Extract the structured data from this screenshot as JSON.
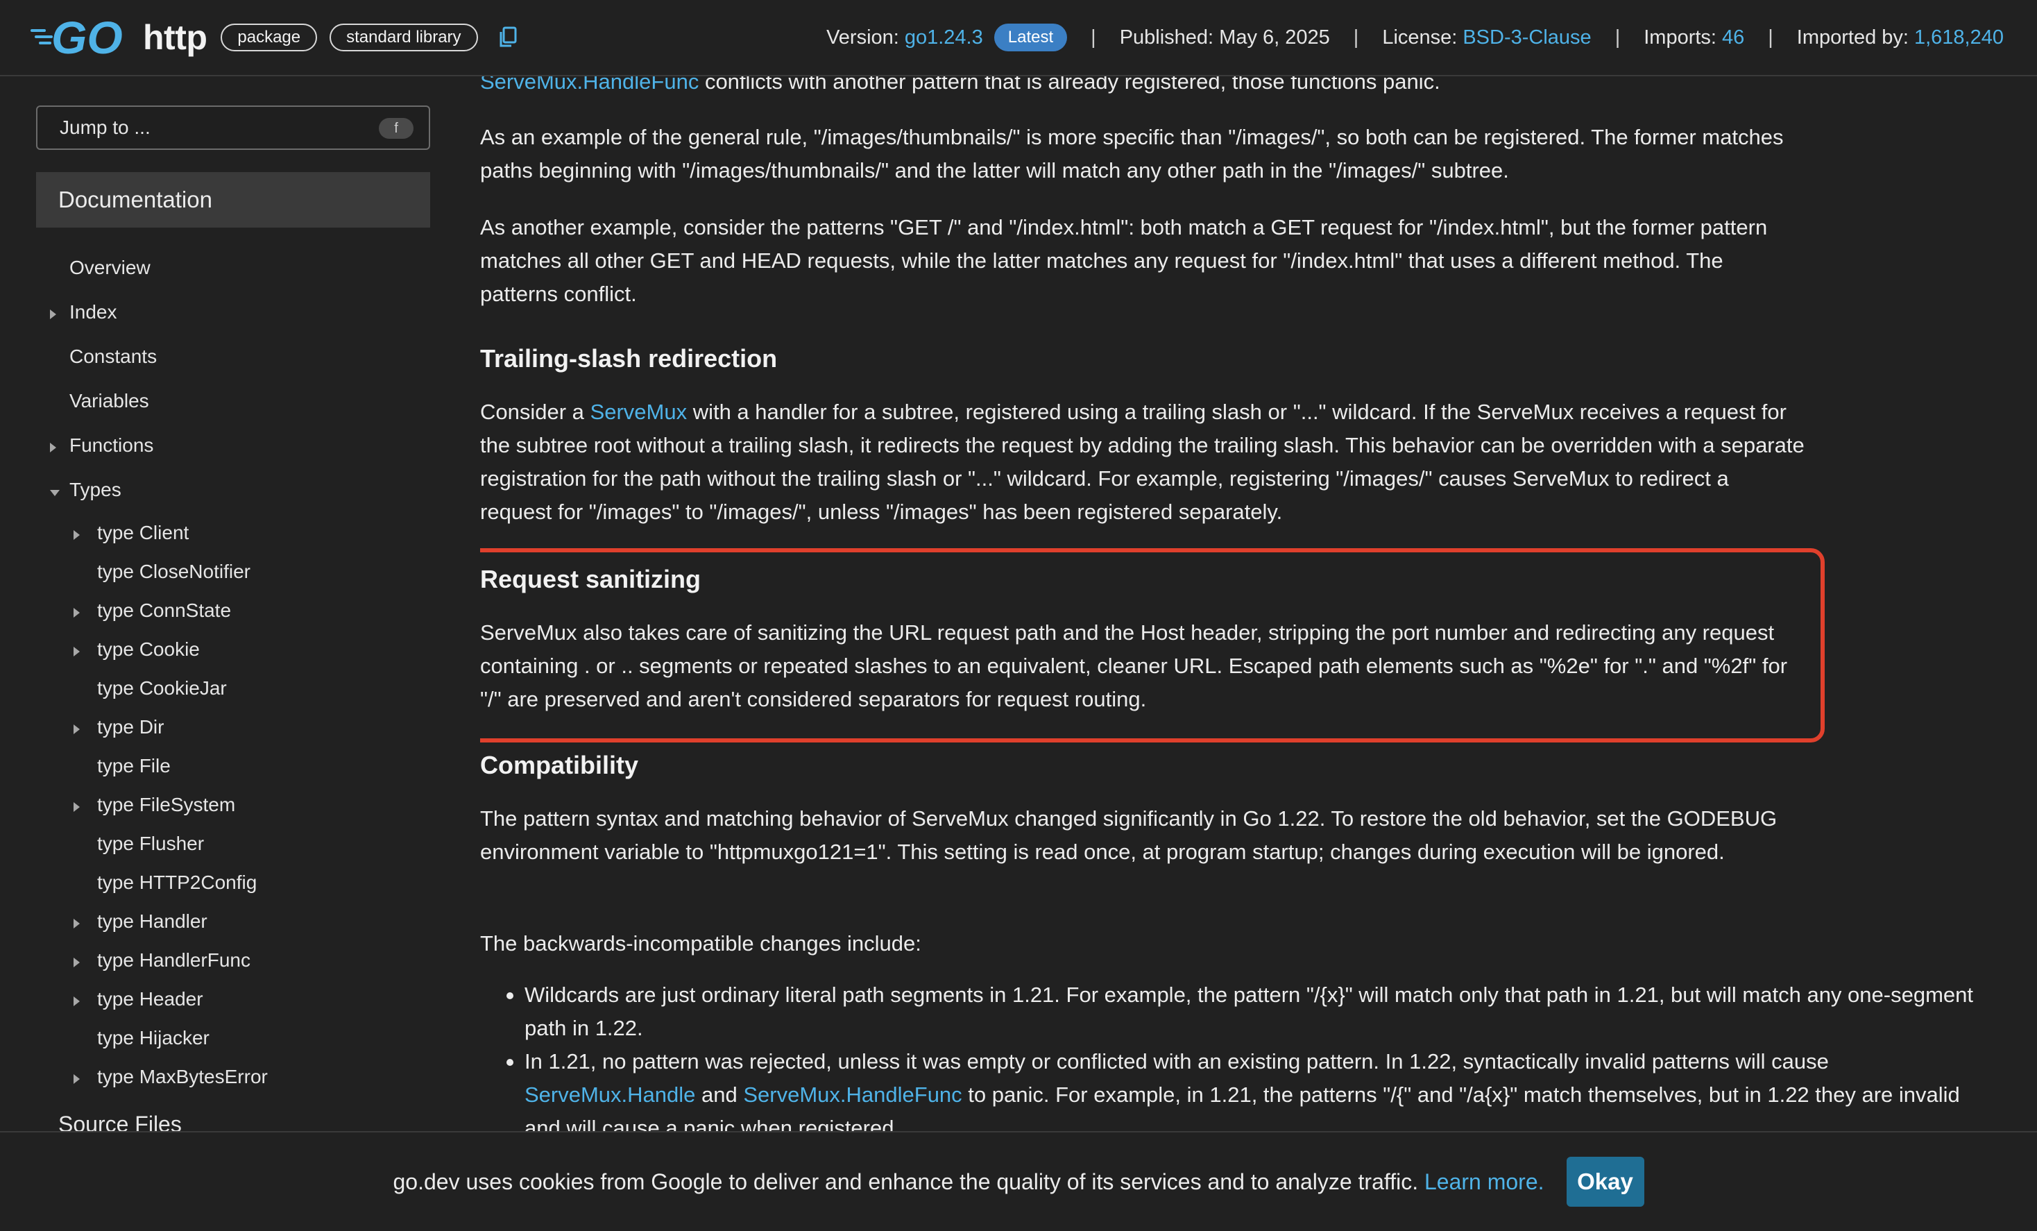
{
  "header": {
    "package_name": "http",
    "chips": [
      "package",
      "standard library"
    ],
    "version_label": "Version:",
    "version_value": "go1.24.3",
    "latest_badge": "Latest",
    "published_label": "Published: May 6, 2025",
    "license_label": "License:",
    "license_value": "BSD-3-Clause",
    "imports_label": "Imports:",
    "imports_value": "46",
    "imported_by_label": "Imported by:",
    "imported_by_value": "1,618,240",
    "separator": "|"
  },
  "sidebar": {
    "jump_placeholder": "Jump to ...",
    "jump_shortcut": "f",
    "doc_heading": "Documentation",
    "items": [
      {
        "label": "Overview",
        "indent": 0,
        "arrow": "none"
      },
      {
        "label": "Index",
        "indent": 0,
        "arrow": "right"
      },
      {
        "label": "Constants",
        "indent": 0,
        "arrow": "none"
      },
      {
        "label": "Variables",
        "indent": 0,
        "arrow": "none"
      },
      {
        "label": "Functions",
        "indent": 0,
        "arrow": "right"
      },
      {
        "label": "Types",
        "indent": 0,
        "arrow": "down"
      },
      {
        "label": "type Client",
        "indent": 1,
        "arrow": "right"
      },
      {
        "label": "type CloseNotifier",
        "indent": 1,
        "arrow": "none"
      },
      {
        "label": "type ConnState",
        "indent": 1,
        "arrow": "right"
      },
      {
        "label": "type Cookie",
        "indent": 1,
        "arrow": "right"
      },
      {
        "label": "type CookieJar",
        "indent": 1,
        "arrow": "none"
      },
      {
        "label": "type Dir",
        "indent": 1,
        "arrow": "right"
      },
      {
        "label": "type File",
        "indent": 1,
        "arrow": "none"
      },
      {
        "label": "type FileSystem",
        "indent": 1,
        "arrow": "right"
      },
      {
        "label": "type Flusher",
        "indent": 1,
        "arrow": "none"
      },
      {
        "label": "type HTTP2Config",
        "indent": 1,
        "arrow": "none"
      },
      {
        "label": "type Handler",
        "indent": 1,
        "arrow": "right"
      },
      {
        "label": "type HandlerFunc",
        "indent": 1,
        "arrow": "right"
      },
      {
        "label": "type Header",
        "indent": 1,
        "arrow": "right"
      },
      {
        "label": "type Hijacker",
        "indent": 1,
        "arrow": "none"
      },
      {
        "label": "type MaxBytesError",
        "indent": 1,
        "arrow": "right"
      }
    ],
    "source_files": "Source Files"
  },
  "main": {
    "top_line": {
      "link": "ServeMux.HandleFunc",
      "text": " conflicts with another pattern that is already registered, those functions panic."
    },
    "p_example1": "As an example of the general rule, \"/images/thumbnails/\" is more specific than \"/images/\", so both can be registered. The former matches paths beginning with \"/images/thumbnails/\" and the latter will match any other path in the \"/images/\" subtree.",
    "p_example2": "As another example, consider the patterns \"GET /\" and \"/index.html\": both match a GET request for \"/index.html\", but the former pattern matches all other GET and HEAD requests, while the latter matches any request for \"/index.html\" that uses a different method. The patterns conflict.",
    "h_trailing": "Trailing-slash redirection",
    "p_trailing_a": "Consider a ",
    "p_trailing_link": "ServeMux",
    "p_trailing_b": " with a handler for a subtree, registered using a trailing slash or \"...\" wildcard. If the ServeMux receives a request for the subtree root without a trailing slash, it redirects the request by adding the trailing slash. This behavior can be overridden with a separate registration for the path without the trailing slash or \"...\" wildcard. For example, registering \"/images/\" causes ServeMux to redirect a request for \"/images\" to \"/images/\", unless \"/images\" has been registered separately.",
    "h_sanitizing": "Request sanitizing",
    "p_sanitizing": "ServeMux also takes care of sanitizing the URL request path and the Host header, stripping the port number and redirecting any request containing . or .. segments or repeated slashes to an equivalent, cleaner URL. Escaped path elements such as \"%2e\" for \".\" and \"%2f\" for \"/\" are preserved and aren't considered separators for request routing.",
    "h_compat": "Compatibility",
    "p_compat": "The pattern syntax and matching behavior of ServeMux changed significantly in Go 1.22. To restore the old behavior, set the GODEBUG environment variable to \"httpmuxgo121=1\". This setting is read once, at program startup; changes during execution will be ignored.",
    "p_backwards": "The backwards-incompatible changes include:",
    "bullet1": "Wildcards are just ordinary literal path segments in 1.21. For example, the pattern \"/{x}\" will match only that path in 1.21, but will match any one-segment path in 1.22.",
    "bullet2_a": "In 1.21, no pattern was rejected, unless it was empty or conflicted with an existing pattern. In 1.22, syntactically invalid patterns will cause ",
    "bullet2_link1": "ServeMux.Handle",
    "bullet2_b": " and ",
    "bullet2_link2": "ServeMux.HandleFunc",
    "bullet2_c": " to panic. For example, in 1.21, the patterns \"/{\" and \"/a{x}\" match themselves, but in 1.22 they are invalid and will cause a panic when registered."
  },
  "cookie": {
    "text": "go.dev uses cookies from Google to deliver and enhance the quality of its services and to analyze traffic.",
    "learn_more": "Learn more.",
    "okay": "Okay"
  },
  "colors": {
    "background": "#212121",
    "link": "#4fb3e8",
    "highlight": "#e0402c",
    "okay_button": "#1f6e94",
    "latest_badge": "#3b7fc4"
  }
}
